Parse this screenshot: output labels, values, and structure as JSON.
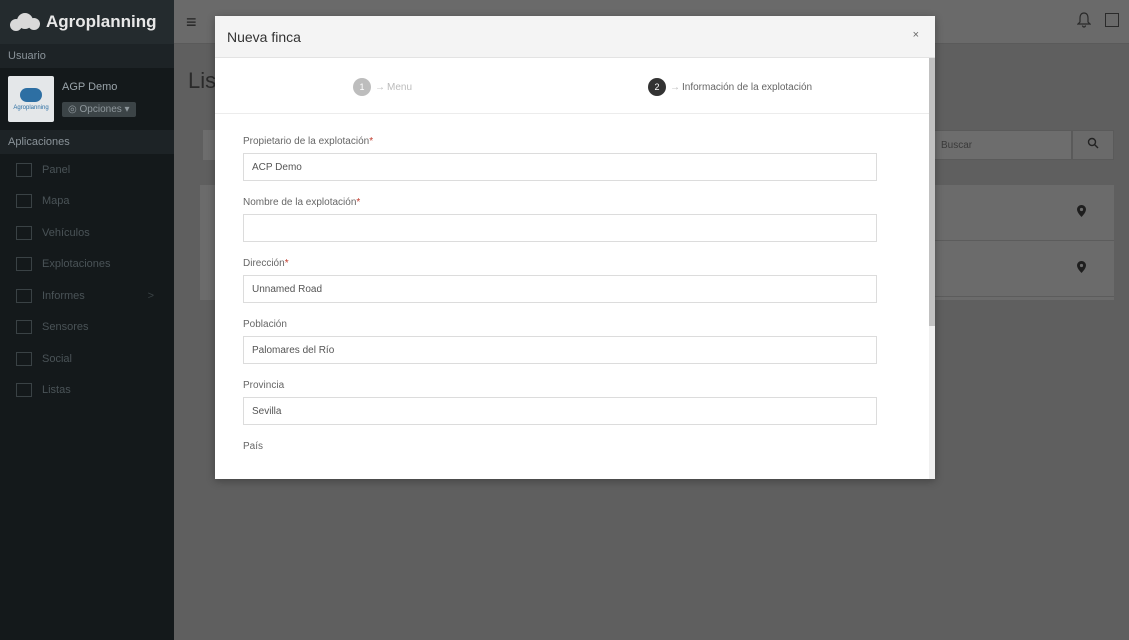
{
  "app": {
    "brand": "Agroplanning"
  },
  "sidebar": {
    "user_section": "Usuario",
    "user_name": "AGP Demo",
    "avatar_text": "Agroplanning",
    "options_button": "◎ Opciones ▾",
    "apps_section": "Aplicaciones",
    "items": [
      {
        "label": "Panel",
        "icon": "grid-icon"
      },
      {
        "label": "Mapa",
        "icon": "map-icon"
      },
      {
        "label": "Vehículos",
        "icon": "vehicle-icon"
      },
      {
        "label": "Explotaciones",
        "icon": "farm-icon"
      },
      {
        "label": "Informes",
        "icon": "report-icon",
        "chevron": ">"
      },
      {
        "label": "Sensores",
        "icon": "sensor-icon"
      },
      {
        "label": "Social",
        "icon": "social-icon"
      },
      {
        "label": "Listas",
        "icon": "list-icon"
      }
    ]
  },
  "topbar": {
    "menu_glyph": "≡",
    "bell_glyph": "🔔"
  },
  "background": {
    "title_fragment": "Lis",
    "search_placeholder": "Buscar",
    "search_glyph": "🔍",
    "pin_glyph": "📍"
  },
  "modal": {
    "title": "Nueva finca",
    "close": "×",
    "steps": [
      {
        "number": "1",
        "label": "Menu",
        "active": false
      },
      {
        "number": "2",
        "label": "Información de la explotación",
        "active": true
      }
    ],
    "fields": [
      {
        "label": "Propietario de la explotación",
        "required": "*",
        "value": "ACP Demo"
      },
      {
        "label": "Nombre de la explotación",
        "required": "*",
        "value": ""
      },
      {
        "label": "Dirección",
        "required": "*",
        "value": "Unnamed Road"
      },
      {
        "label": "Población",
        "required": "",
        "value": "Palomares del Río"
      },
      {
        "label": "Provincia",
        "required": "",
        "value": "Sevilla"
      },
      {
        "label": "País",
        "required": "",
        "value": ""
      }
    ]
  }
}
